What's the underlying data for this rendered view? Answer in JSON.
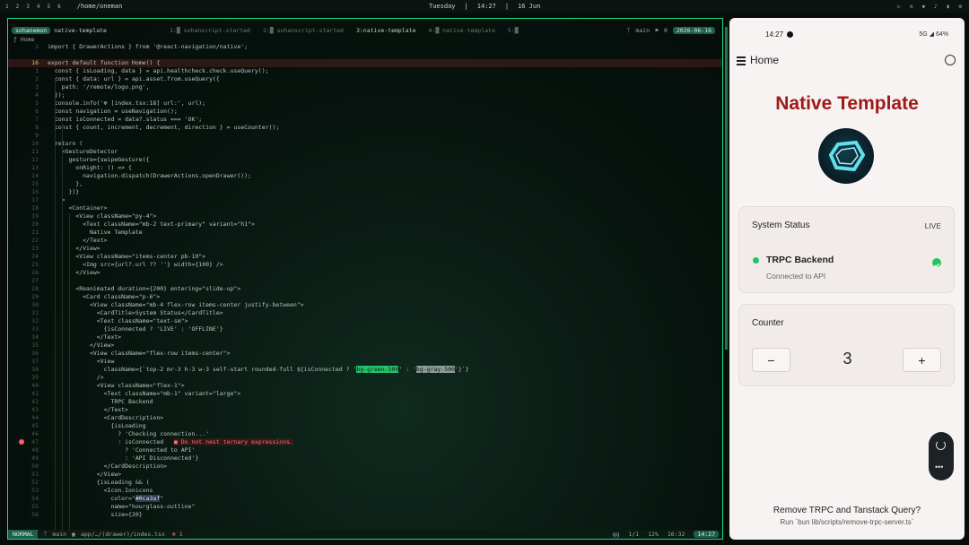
{
  "topbar": {
    "workspaces": [
      "1",
      "2",
      "3",
      "4",
      "5",
      "6"
    ],
    "path": "/home/oneman",
    "day": "Tuesday",
    "time": "14:27",
    "date": "16 Jun"
  },
  "editor": {
    "session": "sohanemon",
    "project": "native-template",
    "tabs": [
      "1:▓ sohanscript-started",
      "2:▓ sohanscript-started",
      "3:native-template",
      "4:▓ native-template",
      "5:▓"
    ],
    "branch": "main",
    "git_count": "0",
    "date_badge": "2026-06-16",
    "breadcrumb": "Home",
    "lines": [
      {
        "n": "2",
        "t": "import { DrawerActions } from '@react-navigation/native';"
      },
      {
        "n": "",
        "t": ""
      },
      {
        "n": "16",
        "t": "export default function Home() {"
      },
      {
        "n": "1",
        "t": "  const { isLoading, data } = api.healthcheck.check.useQuery();"
      },
      {
        "n": "2",
        "t": "  const { data: url } = api.asset.from.useQuery({"
      },
      {
        "n": "3",
        "t": "    path: '/remote/logo.png',"
      },
      {
        "n": "4",
        "t": "  });"
      },
      {
        "n": "5",
        "t": "  console.info('⊕ [index.tsx:18] url:', url);"
      },
      {
        "n": "6",
        "t": "  const navigation = useNavigation();"
      },
      {
        "n": "7",
        "t": "  const isConnected = data?.status === 'OK';"
      },
      {
        "n": "8",
        "t": "  const { count, increment, decrement, direction } = useCounter();"
      },
      {
        "n": "9",
        "t": ""
      },
      {
        "n": "10",
        "t": "  return ("
      },
      {
        "n": "11",
        "t": "    <GestureDetector"
      },
      {
        "n": "12",
        "t": "      gesture={swipeGesture({"
      },
      {
        "n": "13",
        "t": "        onRight: () => {"
      },
      {
        "n": "14",
        "t": "          navigation.dispatch(DrawerActions.openDrawer());"
      },
      {
        "n": "15",
        "t": "        },"
      },
      {
        "n": "16",
        "t": "      })}"
      },
      {
        "n": "17",
        "t": "    >"
      },
      {
        "n": "18",
        "t": "      <Container>"
      },
      {
        "n": "19",
        "t": "        <View className=\"py-4\">"
      },
      {
        "n": "20",
        "t": "          <Text className=\"mb-2 text-primary\" variant=\"h1\">"
      },
      {
        "n": "21",
        "t": "            Native Template"
      },
      {
        "n": "22",
        "t": "          </Text>"
      },
      {
        "n": "23",
        "t": "        </View>"
      },
      {
        "n": "24",
        "t": "        <View className=\"items-center pb-10\">"
      },
      {
        "n": "25",
        "t": "          <Img src={url?.url ?? ''} width={100} />"
      },
      {
        "n": "26",
        "t": "        </View>"
      },
      {
        "n": "27",
        "t": ""
      },
      {
        "n": "28",
        "t": "        <Reanimated duration={200} entering=\"slide-up\">"
      },
      {
        "n": "29",
        "t": "          <Card className=\"p-6\">"
      },
      {
        "n": "30",
        "t": "            <View className=\"mb-4 flex-row items-center justify-between\">"
      },
      {
        "n": "31",
        "t": "              <CardTitle>System Status</CardTitle>"
      },
      {
        "n": "32",
        "t": "              <Text className=\"text-sm\">"
      },
      {
        "n": "33",
        "t": "                {isConnected ? 'LIVE' : 'OFFLINE'}"
      },
      {
        "n": "34",
        "t": "              </Text>"
      },
      {
        "n": "35",
        "t": "            </View>"
      },
      {
        "n": "36",
        "t": "            <View className=\"flex-row items-center\">"
      },
      {
        "n": "37",
        "t": "              <View"
      },
      {
        "n": "38",
        "t": "                className={`top-2 mr-3 h-3 w-3 self-start rounded-full ${isConnected ? '",
        "hg": "bg-green-500",
        "mid": "' : '",
        "hy": "bg-gray-500",
        "end": "'}`}"
      },
      {
        "n": "39",
        "t": "              />"
      },
      {
        "n": "40",
        "t": "              <View className=\"flex-1\">"
      },
      {
        "n": "41",
        "t": "                <Text className=\"mb-1\" variant=\"large\">"
      },
      {
        "n": "42",
        "t": "                  TRPC Backend"
      },
      {
        "n": "43",
        "t": "                </Text>"
      },
      {
        "n": "44",
        "t": "                <CardDescription>"
      },
      {
        "n": "45",
        "t": "                  {isLoading"
      },
      {
        "n": "46",
        "t": "                    ? 'Checking connection...'"
      },
      {
        "n": "47",
        "t": "                    : isConnected",
        "err": "■ Do not nest ternary expressions."
      },
      {
        "n": "48",
        "t": "                      ? 'Connected to API'"
      },
      {
        "n": "49",
        "t": "                      : 'API Disconnected'}"
      },
      {
        "n": "50",
        "t": "                </CardDescription>"
      },
      {
        "n": "51",
        "t": "              </View>"
      },
      {
        "n": "52",
        "t": "              {isLoading && ("
      },
      {
        "n": "53",
        "t": "                <Icon.Ionicons"
      },
      {
        "n": "54",
        "t": "                  color=\"",
        "hb": "#0ca3af",
        "end": "\""
      },
      {
        "n": "55",
        "t": "                  name=\"hourglass-outline\""
      },
      {
        "n": "56",
        "t": "                  size={20}"
      }
    ],
    "status": {
      "mode": "NORMAL",
      "branch": "main",
      "file": "app/…/(drawer)/index.tsx",
      "errors": "1",
      "lang": "gg",
      "position": "1/1",
      "percent": "12%",
      "cursor": "16:32",
      "clock": "14:27"
    }
  },
  "phone": {
    "statusbar": {
      "time": "14:27",
      "system": "5G ◢ 64%"
    },
    "header_title": "Home",
    "app_title": "Native Template",
    "status_card": {
      "title": "System Status",
      "badge": "LIVE",
      "backend": "TRPC Backend",
      "description": "Connected to API"
    },
    "counter_card": {
      "title": "Counter",
      "value": "3",
      "minus": "−",
      "plus": "+"
    },
    "fab_more": "•••",
    "footer_title": "Remove TRPC and Tanstack Query?",
    "footer_hint": "Run `bun lib/scripts/remove-trpc-server.ts`"
  },
  "colors": {
    "accent": "#14e08a",
    "title_red": "#a11818",
    "live_green": "#22c55e"
  }
}
